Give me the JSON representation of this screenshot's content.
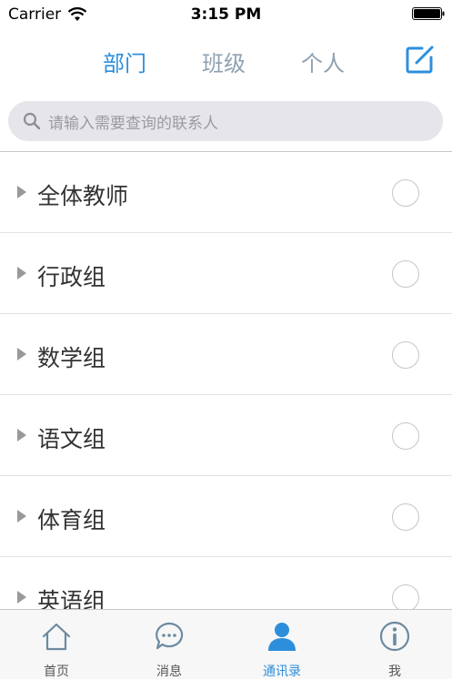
{
  "status_bar": {
    "carrier": "Carrier",
    "time": "3:15 PM"
  },
  "header": {
    "segments": [
      {
        "label": "部门",
        "active": true
      },
      {
        "label": "班级",
        "active": false
      },
      {
        "label": "个人",
        "active": false
      }
    ],
    "edit_icon": "compose-icon"
  },
  "search": {
    "placeholder": "请输入需要查询的联系人",
    "icon": "search-icon"
  },
  "groups": [
    {
      "label": "全体教师",
      "selected": false
    },
    {
      "label": "行政组",
      "selected": false
    },
    {
      "label": "数学组",
      "selected": false
    },
    {
      "label": "语文组",
      "selected": false
    },
    {
      "label": "体育组",
      "selected": false
    },
    {
      "label": "英语组",
      "selected": false
    }
  ],
  "tab_bar": {
    "tabs": [
      {
        "label": "首页",
        "icon": "home-icon",
        "active": false
      },
      {
        "label": "消息",
        "icon": "chat-bubble-icon",
        "active": false
      },
      {
        "label": "通讯录",
        "icon": "person-icon",
        "active": true
      },
      {
        "label": "我",
        "icon": "info-icon",
        "active": false
      }
    ]
  },
  "colors": {
    "accent": "#2d8fdc",
    "inactive": "#8fa2b1"
  }
}
